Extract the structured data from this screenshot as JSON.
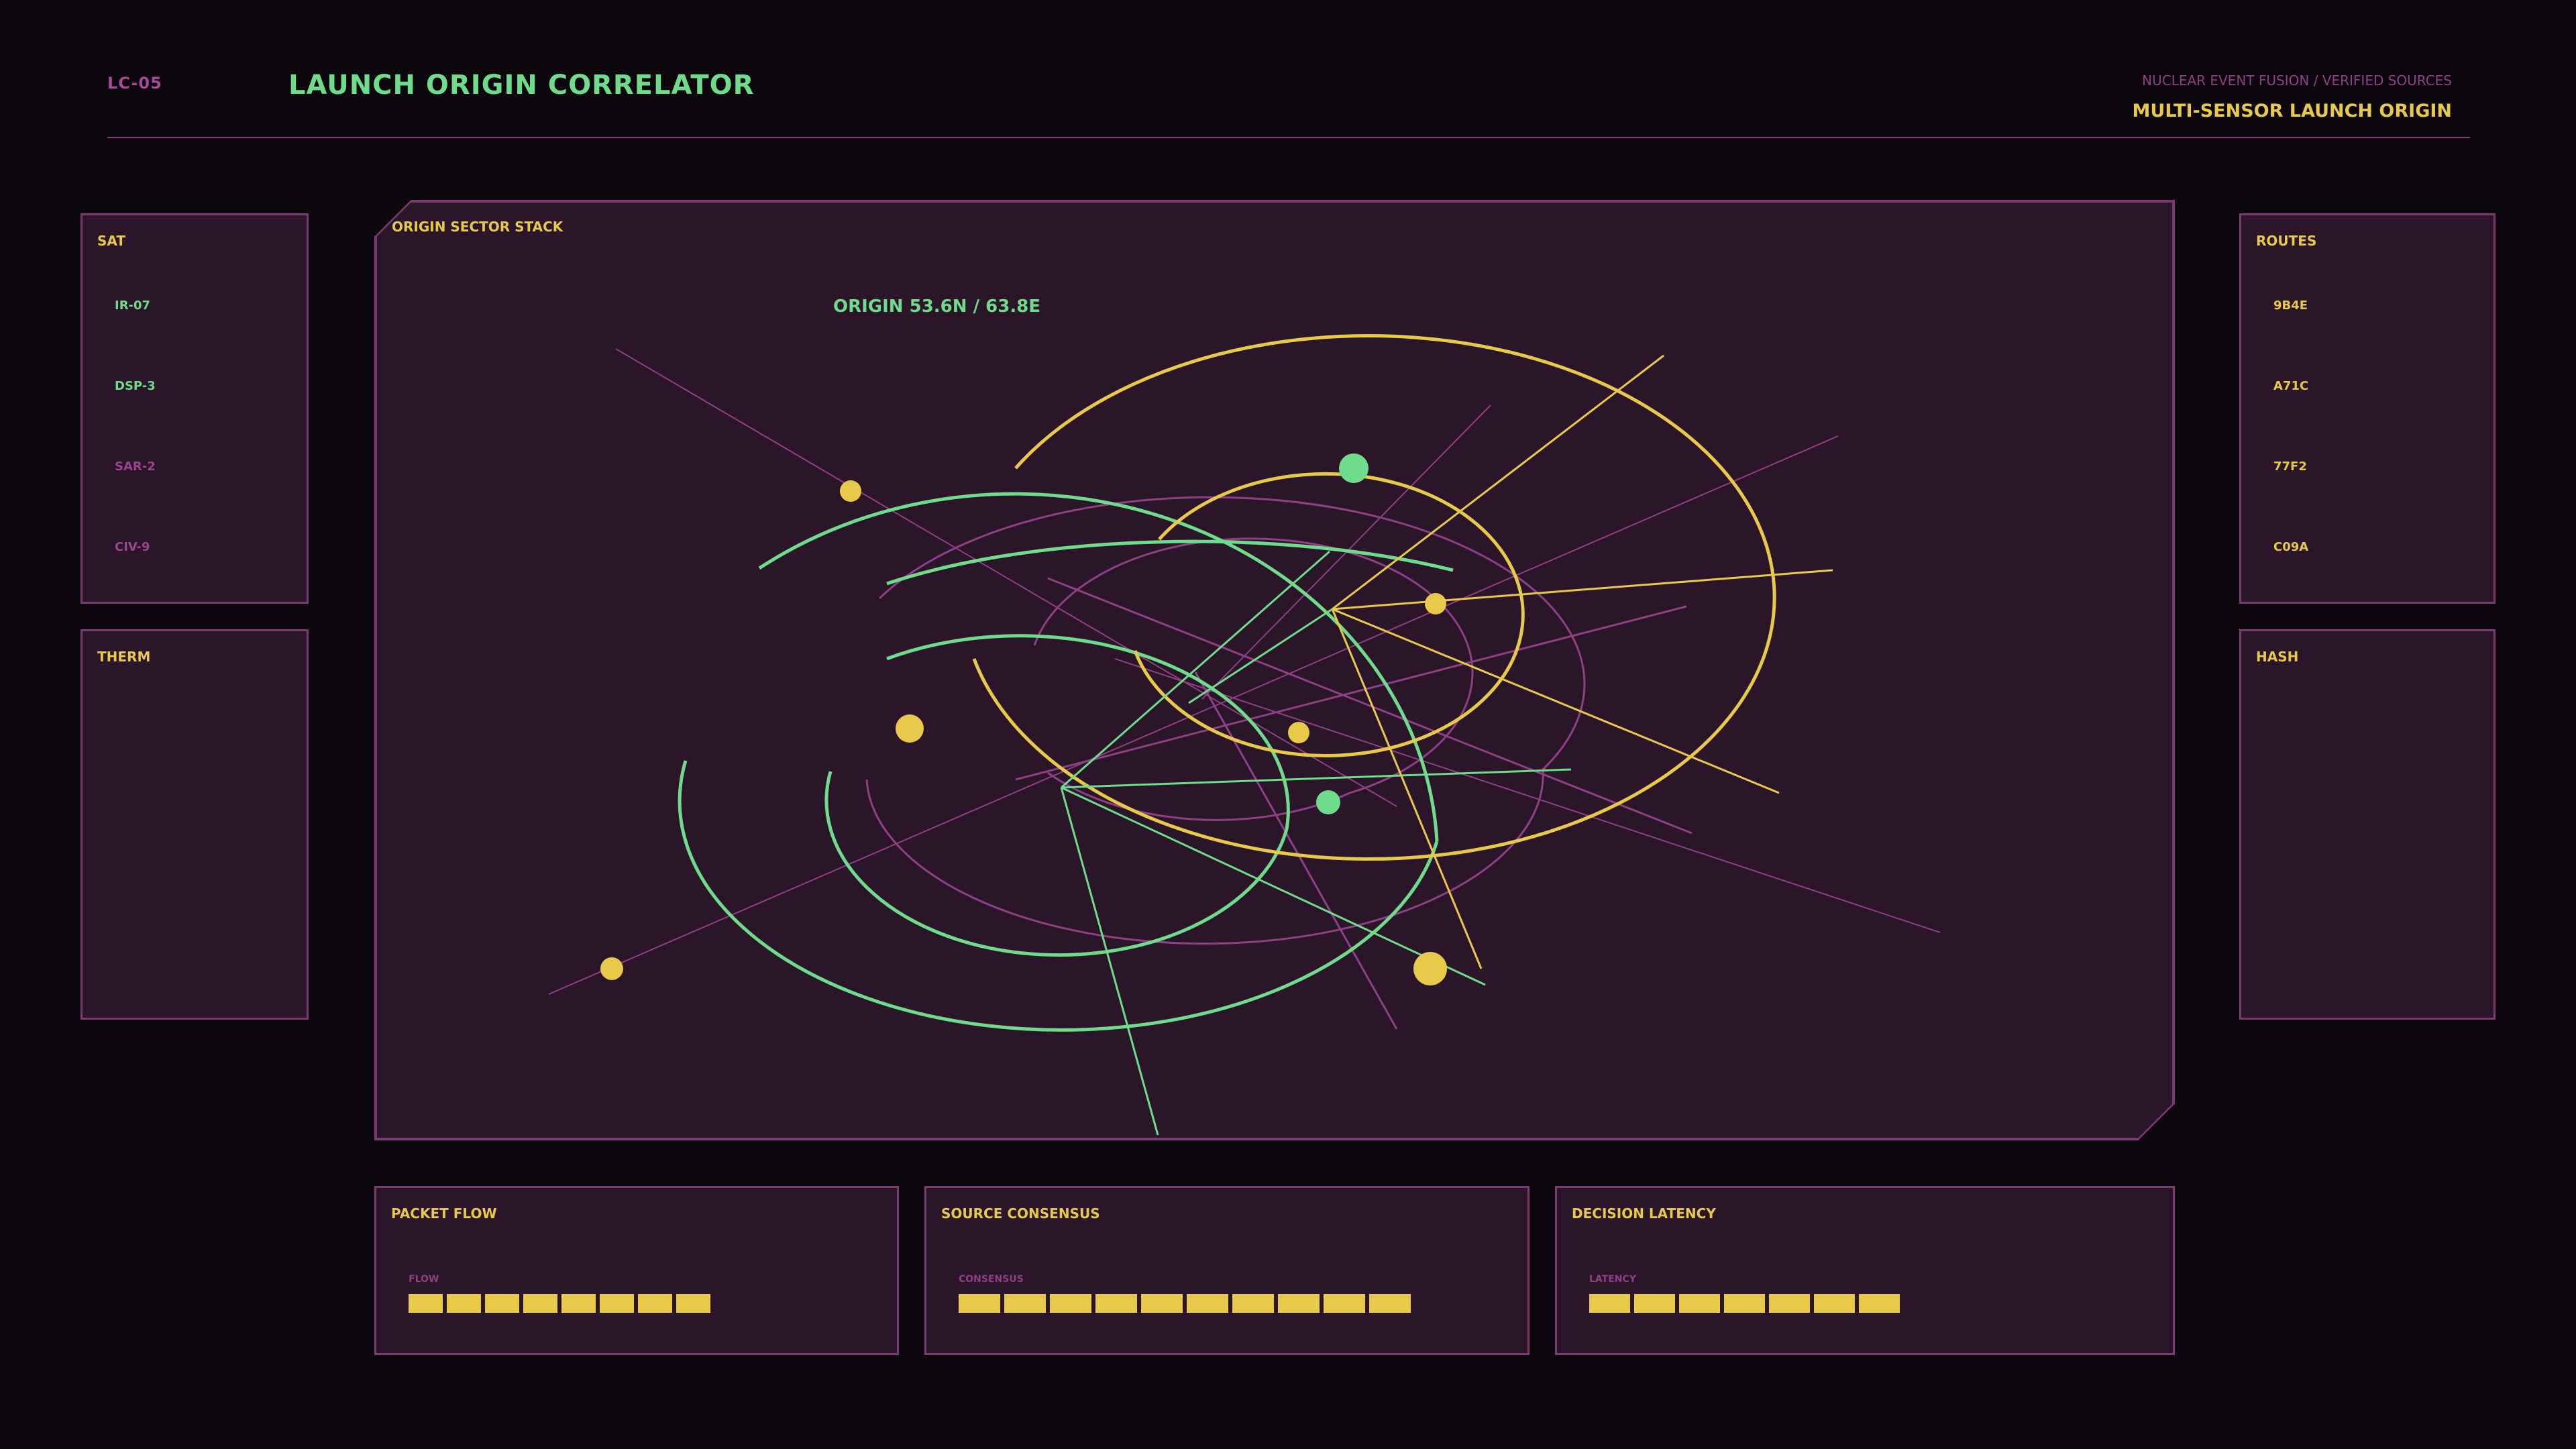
{
  "header": {
    "id": "LC-05",
    "title": "LAUNCH ORIGIN CORRELATOR",
    "subtitle": "NUCLEAR EVENT FUSION / VERIFIED SOURCES",
    "mode": "MULTI-SENSOR LAUNCH ORIGIN"
  },
  "left_panels": {
    "sat": {
      "title": "SAT",
      "items": [
        {
          "label": "IR-07",
          "color": "#6fdc8c"
        },
        {
          "label": "DSP-3",
          "color": "#6fdc8c"
        },
        {
          "label": "SAR-2",
          "color": "#9a4590"
        },
        {
          "label": "CIV-9",
          "color": "#9a4590"
        }
      ]
    },
    "therm": {
      "title": "THERM"
    }
  },
  "right_panels": {
    "routes": {
      "title": "ROUTES",
      "items": [
        {
          "label": "9B4E"
        },
        {
          "label": "A71C"
        },
        {
          "label": "77F2"
        },
        {
          "label": "C09A"
        }
      ]
    },
    "hash": {
      "title": "HASH"
    }
  },
  "main": {
    "title": "ORIGIN SECTOR STACK",
    "origin_readout": "ORIGIN 53.6N / 63.8E"
  },
  "bottom_panels": {
    "packet_flow": {
      "title": "PACKET FLOW",
      "meter_label": "FLOW",
      "segments": 8
    },
    "source_consensus": {
      "title": "SOURCE CONSENSUS",
      "meter_label": "CONSENSUS",
      "segments": 10
    },
    "decision_latency": {
      "title": "DECISION LATENCY",
      "meter_label": "LATENCY",
      "segments": 7
    }
  },
  "colors": {
    "background": "#0c080d",
    "panel": "#2a1628",
    "border": "#7a3a72",
    "accent_green": "#6fdc8c",
    "accent_yellow": "#e8c94a",
    "accent_magenta": "#a84a98"
  }
}
